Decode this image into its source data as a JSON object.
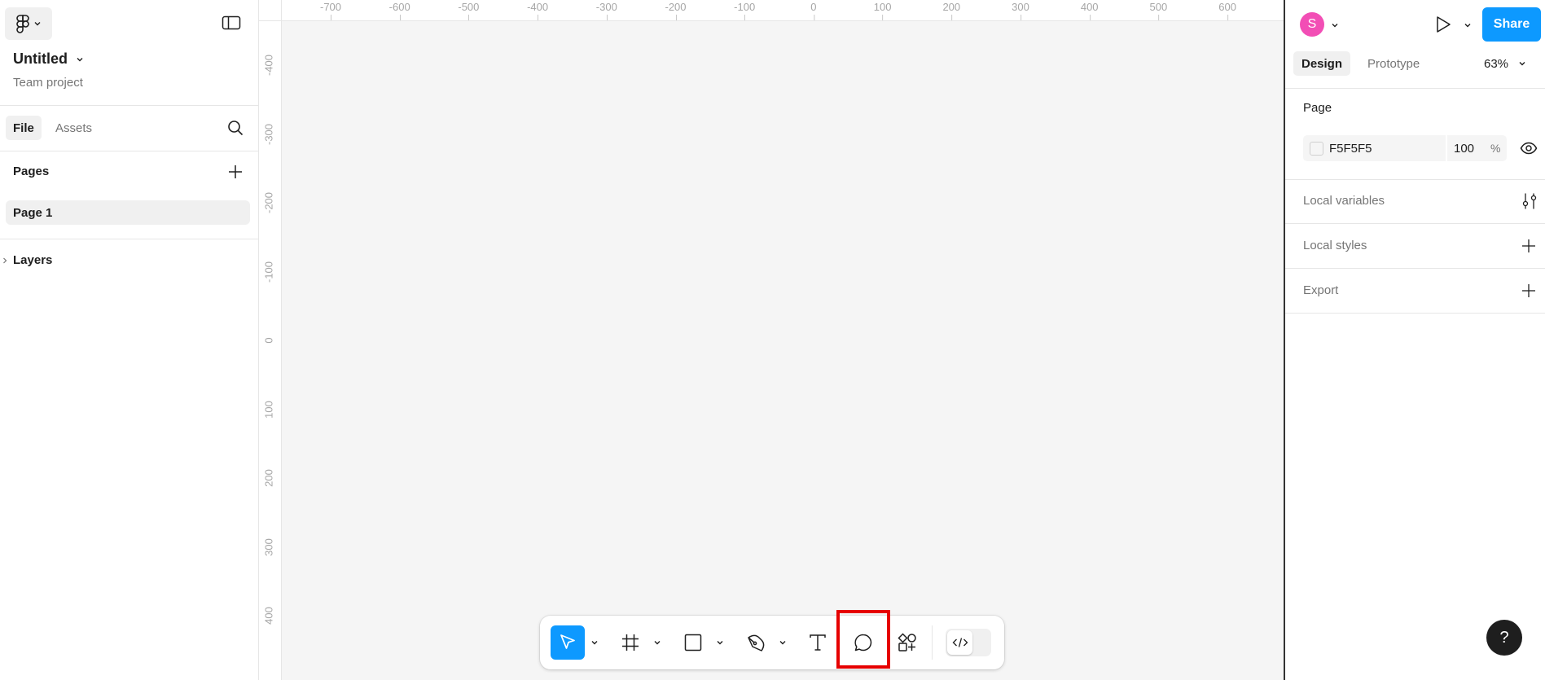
{
  "file": {
    "title": "Untitled",
    "subtitle": "Team project"
  },
  "left_tabs": {
    "file": "File",
    "assets": "Assets"
  },
  "pages": {
    "label": "Pages",
    "items": [
      "Page 1"
    ]
  },
  "layers": {
    "label": "Layers"
  },
  "rulers": {
    "top": [
      "-700",
      "-600",
      "-500",
      "-400",
      "-300",
      "-200",
      "-100",
      "0",
      "100",
      "200",
      "300",
      "400",
      "500",
      "600"
    ],
    "left": [
      "-400",
      "-300",
      "-200",
      "-100",
      "0",
      "100",
      "200",
      "300",
      "400"
    ]
  },
  "toolbar": {
    "tools": [
      "move",
      "frame",
      "rectangle",
      "pen",
      "text",
      "comment",
      "actions",
      "dev-mode"
    ],
    "highlighted_tool": "comment"
  },
  "right": {
    "avatar_initial": "S",
    "share_label": "Share",
    "tabs": {
      "design": "Design",
      "prototype": "Prototype"
    },
    "zoom": "63%",
    "page_section": {
      "title": "Page",
      "color_hex": "F5F5F5",
      "opacity": "100",
      "opacity_unit": "%"
    },
    "local_variables": "Local variables",
    "local_styles": "Local styles",
    "export": "Export"
  },
  "help": {
    "label": "?"
  },
  "colors": {
    "accent": "#0d99ff",
    "avatar": "#f24eb5",
    "canvas": "#f5f5f5",
    "highlight": "#e60000"
  }
}
